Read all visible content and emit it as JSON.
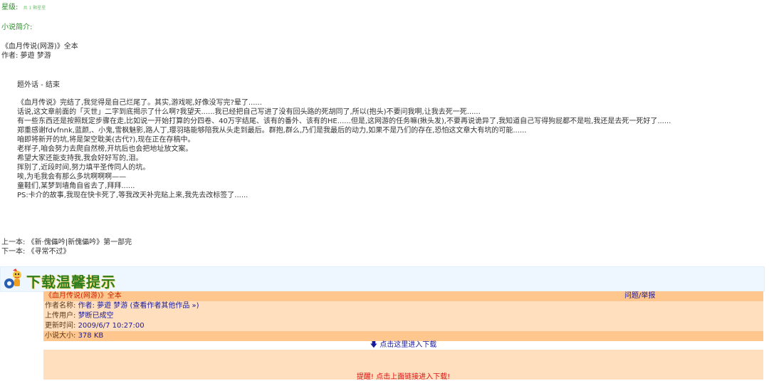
{
  "rating": {
    "label": "星级:",
    "stars_text": "共 1 颗星星"
  },
  "intro": {
    "label": "小说简介:",
    "title_line": "《血月传说(网游)》全本",
    "author_line": "作者: 夢遊 梦游",
    "section_title": "题外话 - 结束",
    "paragraphs": [
      "《血月传说》完结了,我觉得是自己烂尾了。其实,游戏呢,好像没写完?晕了......",
      "话说,这文章前面的「灭世」二字到底揭示了什么啊?我望天......我已经把自己写进了没有回头路的死胡同了,所以(抱头)不要问我啊,让我去死一死......",
      "有一些东西还是按照既定步骤在走,比如说一开始打算的分四卷、40万字结尾、该有的番外、该有的HE......但是,这网游的任务嘛(揪头发),不要再说诡异了,我知道自己写得狗屁都不是啦,我还是去死一死好了......",
      "郑重感谢fdvfnnk,蓝颜,、小鬼,雪枫魅影,路人丁,璎羽珞能够陪我从头走到最后。群抱,群么,乃们是我最后的动力,如果不是乃们的存在,恐怕这文章大有坑的可能......",
      "咱即将新开的坑,将是架空耽美(古代?),现在正在存稿中。",
      "老样子,咱会努力去爬自然榜,开坑后也会把地址放文案。",
      "希望大家还能支持我,我会好好写的,泪。",
      "挥别了,近段时间,努力填平圣传同人的坑。",
      "唉,为毛我会有那么多坑啊啊啊——",
      "童鞋们,某梦到墙角自省去了,拜拜......",
      "PS:卡介的故事,我现在快卡死了,等我改天补完贴上来,我先去改标签了......"
    ]
  },
  "nav": {
    "prev": "上一本: 《新·傀儡吟|新傀儡吟》第一部完",
    "next": "下一本: 《寻常不过》"
  },
  "download_tip": {
    "title": "下载温馨提示",
    "mascot_icon": "download-mascot-icon"
  },
  "info": {
    "book_title": "《血月传说(网游)》全本",
    "report_link": "问题/举报",
    "author_label": "作者名称:",
    "author_value": "作者: 夢遊 梦游 (查看作者其他作品 »)",
    "uploader_label": "上传用户:",
    "uploader_value": "梦断已成空",
    "updated_label": "更新时间:",
    "updated_value": "2009/6/7 10:27:00",
    "size_label": "小说大小:",
    "size_value": "378 KB"
  },
  "download": {
    "arrow_icon": "arrow-down-icon",
    "link_text": "点击这里进入下载",
    "notice": "提醒! 点击上面链接进入下载!"
  },
  "colors": {
    "green_label": "#2f8f2f",
    "row_dark": "#ffc78e",
    "row_light": "#ffdfbe",
    "link": "#1a1a9c",
    "notice_red": "#dd1111"
  }
}
